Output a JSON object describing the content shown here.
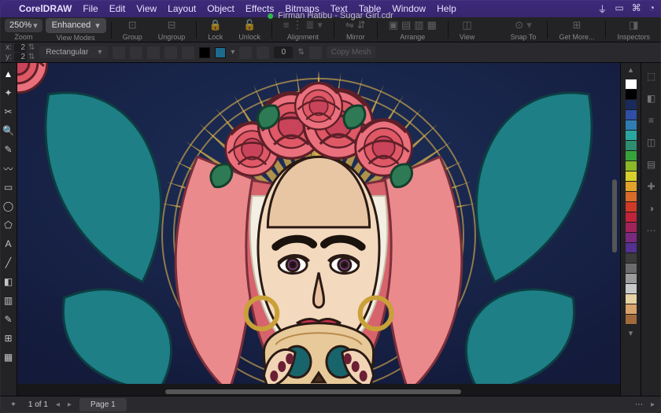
{
  "menubar": {
    "app": "CorelDRAW",
    "items": [
      "File",
      "Edit",
      "View",
      "Layout",
      "Object",
      "Effects",
      "Bitmaps",
      "Text",
      "Table",
      "Window",
      "Help"
    ]
  },
  "document": {
    "title": "Firman Hatibu - Sugar Girl.cdr"
  },
  "toolbar": {
    "zoom": "250%",
    "zoom_label": "Zoom",
    "viewmode": "Enhanced",
    "viewmode_label": "View Modes",
    "group_label": "Group",
    "ungroup_label": "Ungroup",
    "lock_label": "Lock",
    "unlock_label": "Unlock",
    "alignment_label": "Alignment",
    "mirror_label": "Mirror",
    "arrange_label": "Arrange",
    "view_label": "View",
    "snapto_label": "Snap To",
    "getmore_label": "Get More...",
    "inspectors_label": "Inspectors"
  },
  "propbar": {
    "x_label": "x:",
    "y_label": "y:",
    "x": "2",
    "y": "2",
    "wrap": "Rectangular",
    "outline": "0",
    "copymesh": "Copy Mesh"
  },
  "tools": [
    "pick",
    "shape",
    "crop",
    "zoom",
    "freehand",
    "artistic",
    "rect",
    "ellipse",
    "polygon",
    "text",
    "parallel",
    "fill",
    "outline",
    "eyedrop",
    "mesh",
    "transparency"
  ],
  "tool_glyphs": [
    "▲",
    "✦",
    "✂",
    "🔍",
    "✎",
    "〰",
    "▭",
    "◯",
    "⬠",
    "A",
    "╱",
    "◧",
    "▥",
    "✎",
    "⊞",
    "▦"
  ],
  "colors": [
    "#ffffff",
    "#000000",
    "#1a2a5a",
    "#2e4fa5",
    "#2f7db4",
    "#2aa6a0",
    "#2e8c6f",
    "#37a23c",
    "#8ab82a",
    "#d7cf2d",
    "#e0a22b",
    "#d86b27",
    "#cf3a28",
    "#c0233a",
    "#a2235a",
    "#7a2a7e",
    "#54308f",
    "#3b3b3b",
    "#6b6b6b",
    "#9c9c9c",
    "#c9c9c9",
    "#e6d3a3",
    "#d9a36c",
    "#a06a3a"
  ],
  "inspector_icons": [
    "⬚",
    "◧",
    "≡",
    "◫",
    "▤",
    "✚",
    "◑",
    "⋯"
  ],
  "status": {
    "page_current": "1",
    "page_total": "1",
    "of": "of",
    "page_label": "Page 1",
    "add": "+",
    "more": "⋯"
  }
}
